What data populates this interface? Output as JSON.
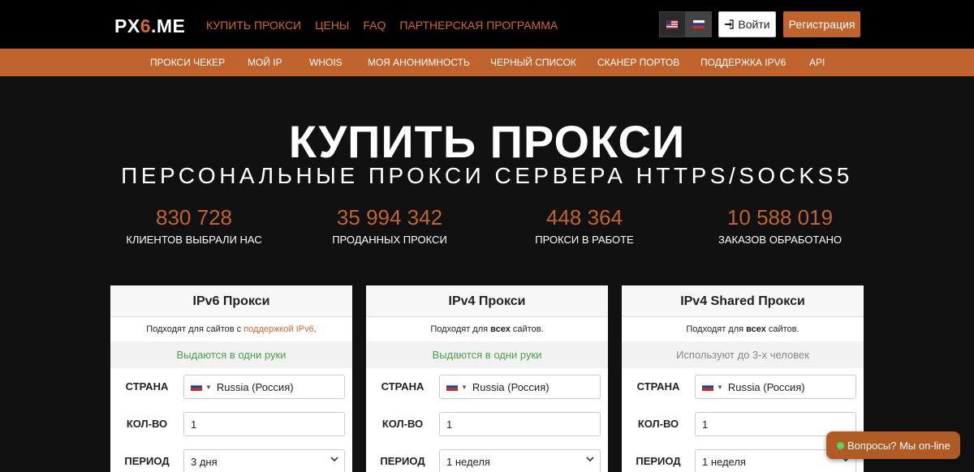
{
  "header": {
    "logo_prefix": "PX",
    "logo_accent": "6",
    "logo_suffix": ".ME",
    "nav": [
      "КУПИТЬ ПРОКСИ",
      "ЦЕНЫ",
      "FAQ",
      "ПАРТНЕРСКАЯ ПРОГРАММА"
    ],
    "login_label": "Войти",
    "register_label": "Регистрация"
  },
  "subnav": [
    "ПРОКСИ ЧЕКЕР",
    "МОЙ IP",
    "WHOIS",
    "МОЯ АНОНИМНОСТЬ",
    "ЧЕРНЫЙ СПИСОК",
    "СКАНЕР ПОРТОВ",
    "ПОДДЕРЖКА IPV6",
    "API"
  ],
  "hero": {
    "title": "КУПИТЬ ПРОКСИ",
    "subtitle": "ПЕРСОНАЛЬНЫЕ ПРОКСИ СЕРВЕРА HTTPS/SOCKS5"
  },
  "stats": [
    {
      "value": "830 728",
      "label": "КЛИЕНТОВ ВЫБРАЛИ НАС"
    },
    {
      "value": "35 994 342",
      "label": "ПРОДАННЫХ ПРОКСИ"
    },
    {
      "value": "448 364",
      "label": "ПРОКСИ В РАБОТЕ"
    },
    {
      "value": "10 588 019",
      "label": "ЗАКАЗОВ ОБРАБОТАНО"
    }
  ],
  "cards": [
    {
      "title": "IPv6 Прокси",
      "desc_pre": "Подходят для сайтов с ",
      "desc_link": "поддержкой IPv6",
      "desc_post": ".",
      "note": "Выдаются в одни руки",
      "country_label": "СТРАНА",
      "country_value": "Russia (Россия)",
      "qty_label": "КОЛ-ВО",
      "qty_value": "1",
      "period_label": "ПЕРИОД",
      "period_value": "3 дня"
    },
    {
      "title": "IPv4 Прокси",
      "desc_pre": "Подходят для ",
      "desc_bold": "всех",
      "desc_post": " сайтов.",
      "note": "Выдаются в одни руки",
      "country_label": "СТРАНА",
      "country_value": "Russia (Россия)",
      "qty_label": "КОЛ-ВО",
      "qty_value": "1",
      "period_label": "ПЕРИОД",
      "period_value": "1 неделя"
    },
    {
      "title": "IPv4 Shared Прокси",
      "desc_pre": "Подходят для ",
      "desc_bold": "всех",
      "desc_post": " сайтов.",
      "note": "Используют до 3-х человек",
      "country_label": "СТРАНА",
      "country_value": "Russia (Россия)",
      "qty_label": "КОЛ-ВО",
      "qty_value": "1",
      "period_label": "ПЕРИОД",
      "period_value": "1 неделя"
    }
  ],
  "chat": {
    "label": "Вопросы? Мы on-line"
  },
  "colors": {
    "accent": "#c0632c",
    "link": "#d2692f",
    "note_green": "#4aa04a"
  },
  "icons": [
    "us-flag-icon",
    "ru-flag-icon",
    "sign-in-icon",
    "ru-flag-icon",
    "chevron-down-icon",
    "online-dot-icon"
  ]
}
